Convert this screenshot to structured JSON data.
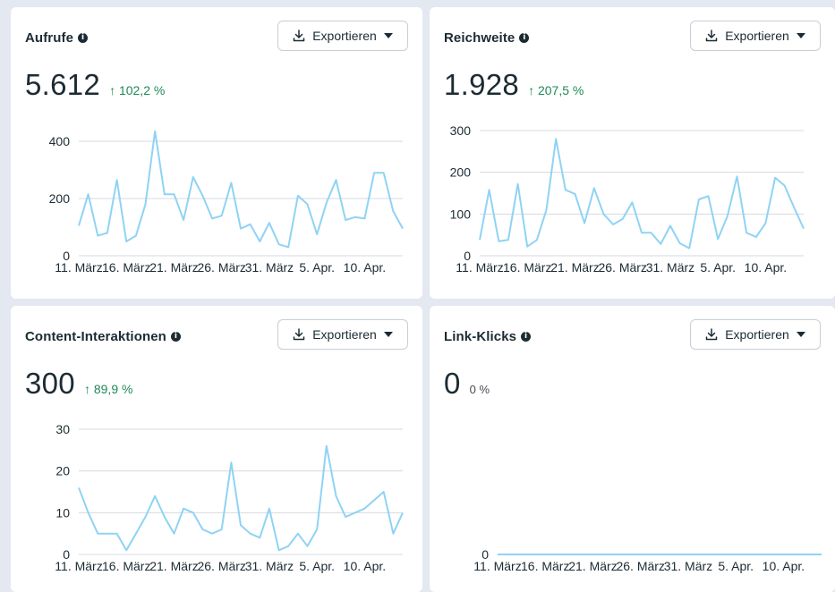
{
  "colors": {
    "line": "#8fd3f4",
    "positive": "#1d8a57",
    "grid": "#d6dae0"
  },
  "icons": {
    "info": "info-icon",
    "download": "download-icon",
    "caret": "caret-down-icon"
  },
  "cards": [
    {
      "title": "Aufrufe",
      "export_label": "Exportieren",
      "value": "5.612",
      "change": "↑ 102,2 %",
      "change_positive": true,
      "chart_data": {
        "type": "line",
        "x_tick_labels": [
          "11. März",
          "16. März",
          "21. März",
          "26. März",
          "31. März",
          "5. Apr.",
          "10. Apr."
        ],
        "y_ticks": [
          0,
          200,
          400
        ],
        "ylim": [
          0,
          500
        ],
        "grid": true,
        "values": [
          105,
          215,
          70,
          80,
          265,
          50,
          70,
          180,
          435,
          215,
          215,
          125,
          275,
          210,
          130,
          140,
          255,
          95,
          110,
          50,
          115,
          40,
          30,
          210,
          180,
          75,
          185,
          265,
          125,
          135,
          130,
          290,
          290,
          155,
          95
        ]
      }
    },
    {
      "title": "Reichweite",
      "export_label": "Exportieren",
      "value": "1.928",
      "change": "↑ 207,5 %",
      "change_positive": true,
      "chart_data": {
        "type": "line",
        "x_tick_labels": [
          "11. März",
          "16. März",
          "21. März",
          "26. März",
          "31. März",
          "5. Apr.",
          "10. Apr."
        ],
        "y_ticks": [
          0,
          100,
          200,
          300
        ],
        "ylim": [
          0,
          300
        ],
        "grid": true,
        "values": [
          38,
          158,
          35,
          38,
          172,
          22,
          38,
          110,
          280,
          158,
          148,
          78,
          162,
          100,
          75,
          88,
          128,
          55,
          55,
          28,
          72,
          30,
          18,
          135,
          143,
          40,
          95,
          190,
          55,
          45,
          78,
          187,
          168,
          115,
          65
        ]
      }
    },
    {
      "title": "Content-Interaktionen",
      "export_label": "Exportieren",
      "value": "300",
      "change": "↑ 89,9 %",
      "change_positive": true,
      "chart_data": {
        "type": "line",
        "x_tick_labels": [
          "11. März",
          "16. März",
          "21. März",
          "26. März",
          "31. März",
          "5. Apr.",
          "10. Apr."
        ],
        "y_ticks": [
          0,
          10,
          20,
          30
        ],
        "ylim": [
          0,
          30
        ],
        "grid": true,
        "values": [
          16,
          10,
          5,
          5,
          5,
          1,
          5,
          9,
          14,
          9,
          5,
          11,
          10,
          6,
          5,
          6,
          22,
          7,
          5,
          4,
          11,
          1,
          2,
          5,
          2,
          6,
          26,
          14,
          9,
          10,
          11,
          13,
          15,
          5,
          10
        ]
      }
    },
    {
      "title": "Link-Klicks",
      "export_label": "Exportieren",
      "value": "0",
      "change": "0 %",
      "change_positive": false,
      "chart_data": {
        "type": "line",
        "x_tick_labels": [
          "11. März",
          "16. März",
          "21. März",
          "26. März",
          "31. März",
          "5. Apr.",
          "10. Apr."
        ],
        "y_ticks": [
          0
        ],
        "ylim": [
          0,
          1
        ],
        "grid": false,
        "values": [
          0,
          0,
          0,
          0,
          0,
          0,
          0,
          0,
          0,
          0,
          0,
          0,
          0,
          0,
          0,
          0,
          0,
          0,
          0,
          0,
          0,
          0,
          0,
          0,
          0,
          0,
          0,
          0,
          0,
          0,
          0,
          0,
          0,
          0,
          0
        ]
      }
    }
  ]
}
